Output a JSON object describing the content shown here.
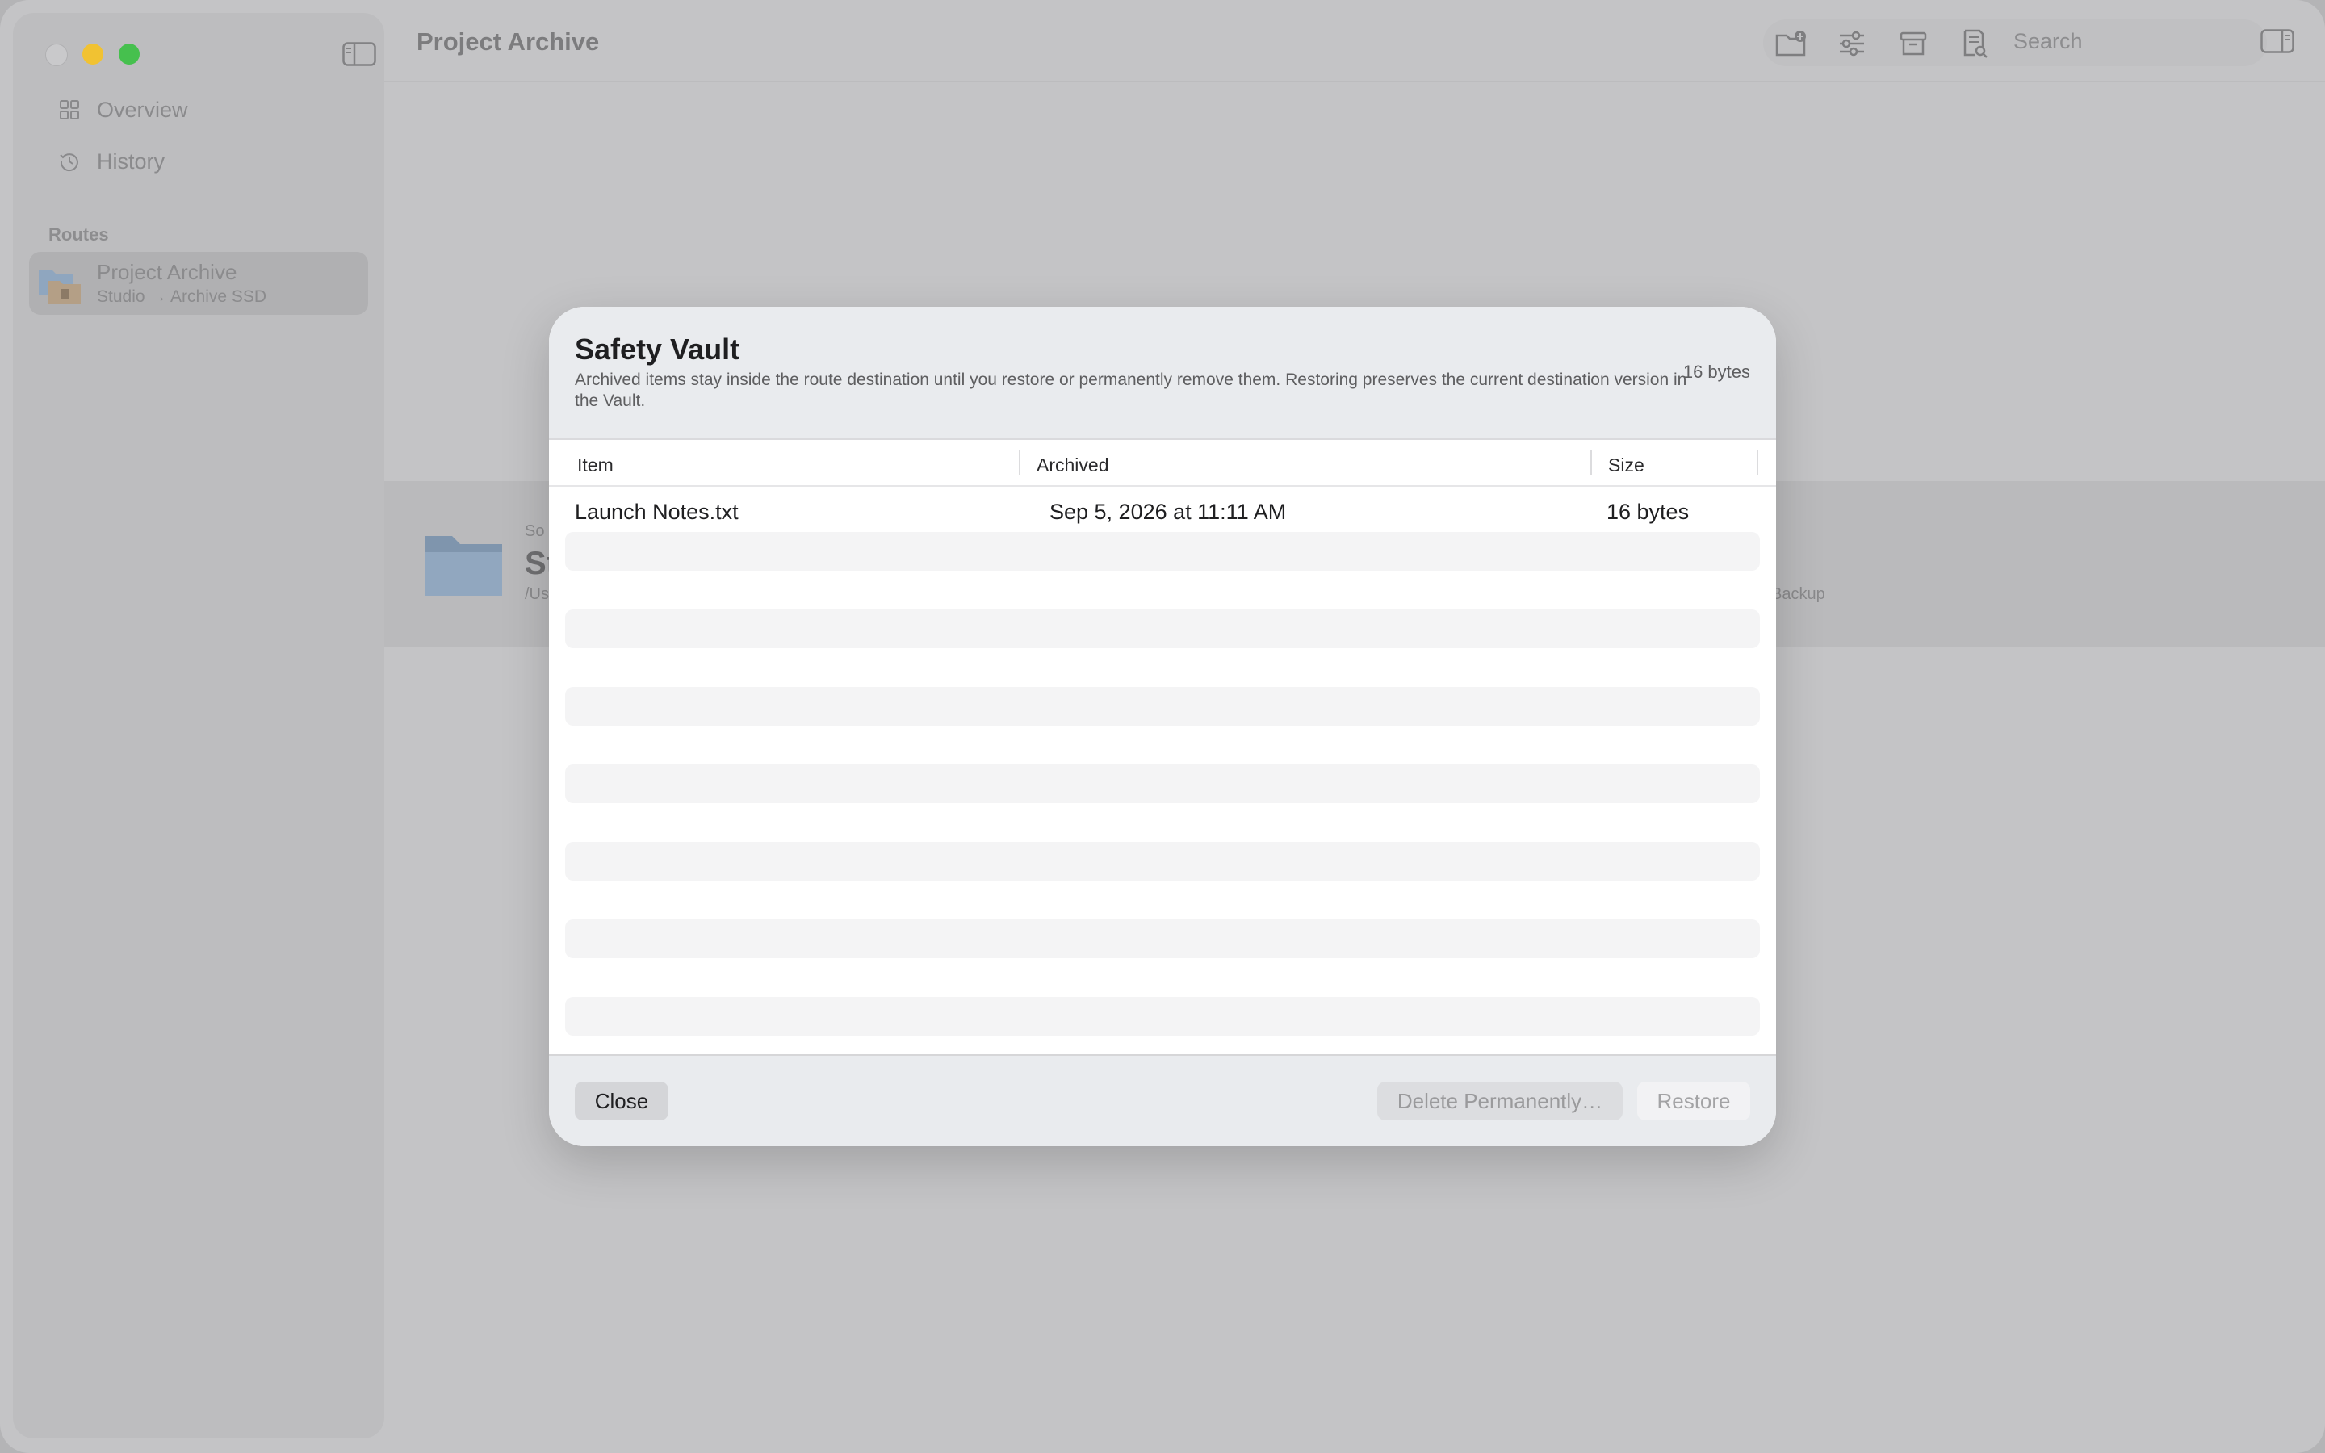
{
  "window": {
    "title": "Project Archive"
  },
  "sidebar": {
    "items": [
      {
        "label": "Overview",
        "icon": "grid-icon"
      },
      {
        "label": "History",
        "icon": "clock-history-icon"
      }
    ],
    "section_label": "Routes",
    "route": {
      "title": "Project Archive",
      "subtitle": "Studio → Archive SSD"
    }
  },
  "toolbar": {
    "icons": [
      "new-folder-icon",
      "sliders-icon",
      "archive-box-icon",
      "document-search-icon"
    ],
    "search_placeholder": "Search"
  },
  "background_card": {
    "source_label_fragment": "So",
    "name_fragment": "St",
    "path_fragment": "/Us",
    "destination_fragment": "Backup"
  },
  "modal": {
    "title": "Safety Vault",
    "description": "Archived items stay inside the route destination until you restore or permanently remove them. Restoring preserves the current destination version in the Vault.",
    "total_size": "16 bytes",
    "columns": [
      "Item",
      "Archived",
      "Size"
    ],
    "rows": [
      {
        "item": "Launch Notes.txt",
        "archived": "Sep 5, 2026 at 11:11 AM",
        "size": "16 bytes"
      }
    ],
    "buttons": {
      "close": "Close",
      "delete": "Delete Permanently…",
      "restore": "Restore"
    }
  },
  "colors": {
    "traffic_close": "#c9c9cb",
    "traffic_minimize": "#f1c232",
    "traffic_maximize": "#46c04e",
    "modal_header": "#e9ebee"
  }
}
